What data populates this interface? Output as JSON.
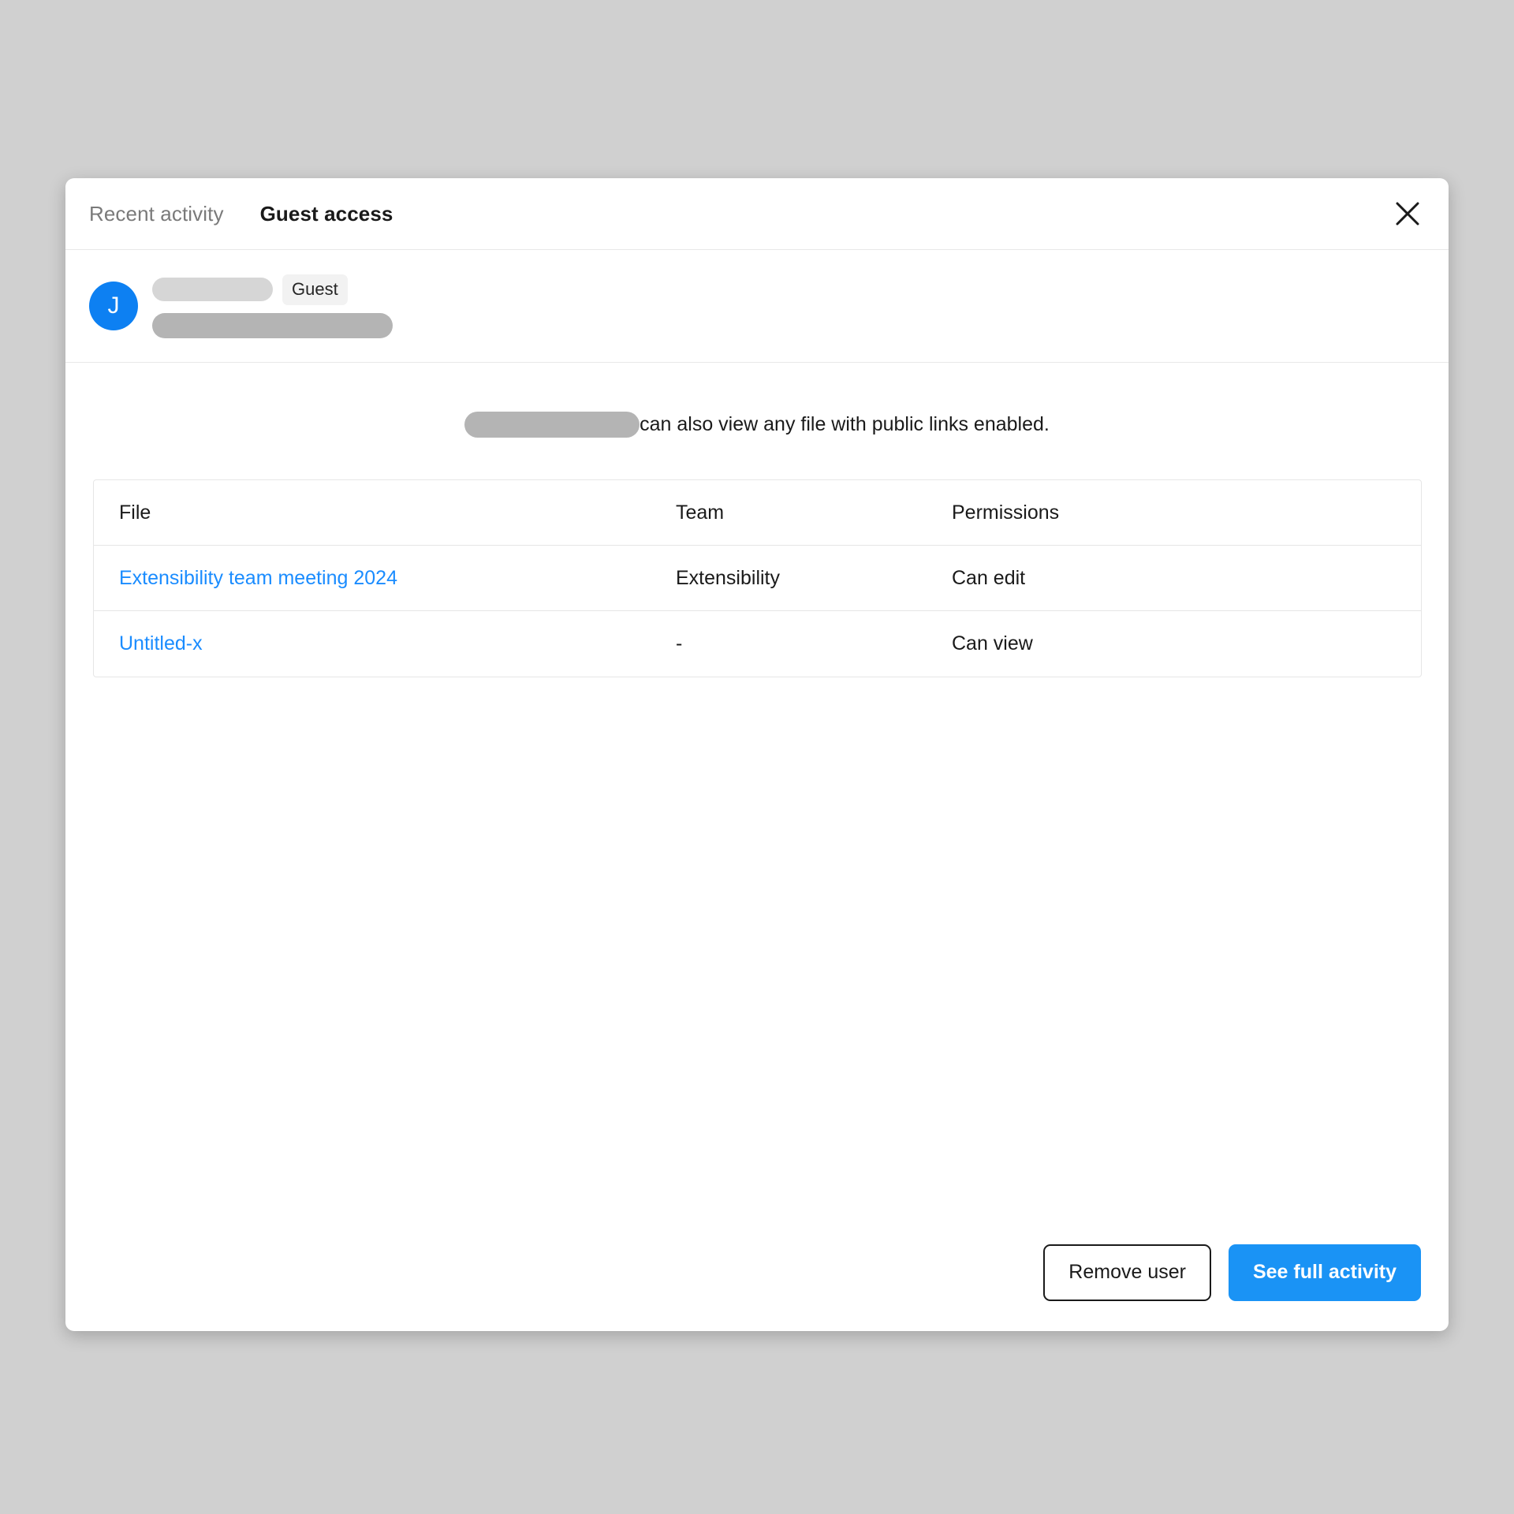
{
  "modal": {
    "tabs": [
      {
        "label": "Recent activity",
        "active": false
      },
      {
        "label": "Guest access",
        "active": true
      }
    ],
    "close_icon": "close-icon",
    "user": {
      "avatar_initial": "J",
      "name_redacted": true,
      "email_redacted": true,
      "badge": "Guest"
    },
    "notice": {
      "subject_redacted": true,
      "text": "can also view any file with public links enabled."
    },
    "table": {
      "columns": [
        "File",
        "Team",
        "Permissions"
      ],
      "rows": [
        {
          "file": "Extensibility team meeting 2024",
          "team": "Extensibility",
          "permissions": "Can edit"
        },
        {
          "file": "Untitled-x",
          "team": "-",
          "permissions": "Can view"
        }
      ]
    },
    "footer": {
      "secondary_label": "Remove user",
      "primary_label": "See full activity"
    },
    "colors": {
      "accent_blue": "#1a93f5",
      "avatar_blue": "#0d80f2",
      "link_blue": "#1a8cff",
      "page_background": "#d0d0d0",
      "badge_background": "#f2f2f2",
      "redact_light": "#d6d6d6",
      "redact_dark": "#b4b4b4"
    }
  }
}
